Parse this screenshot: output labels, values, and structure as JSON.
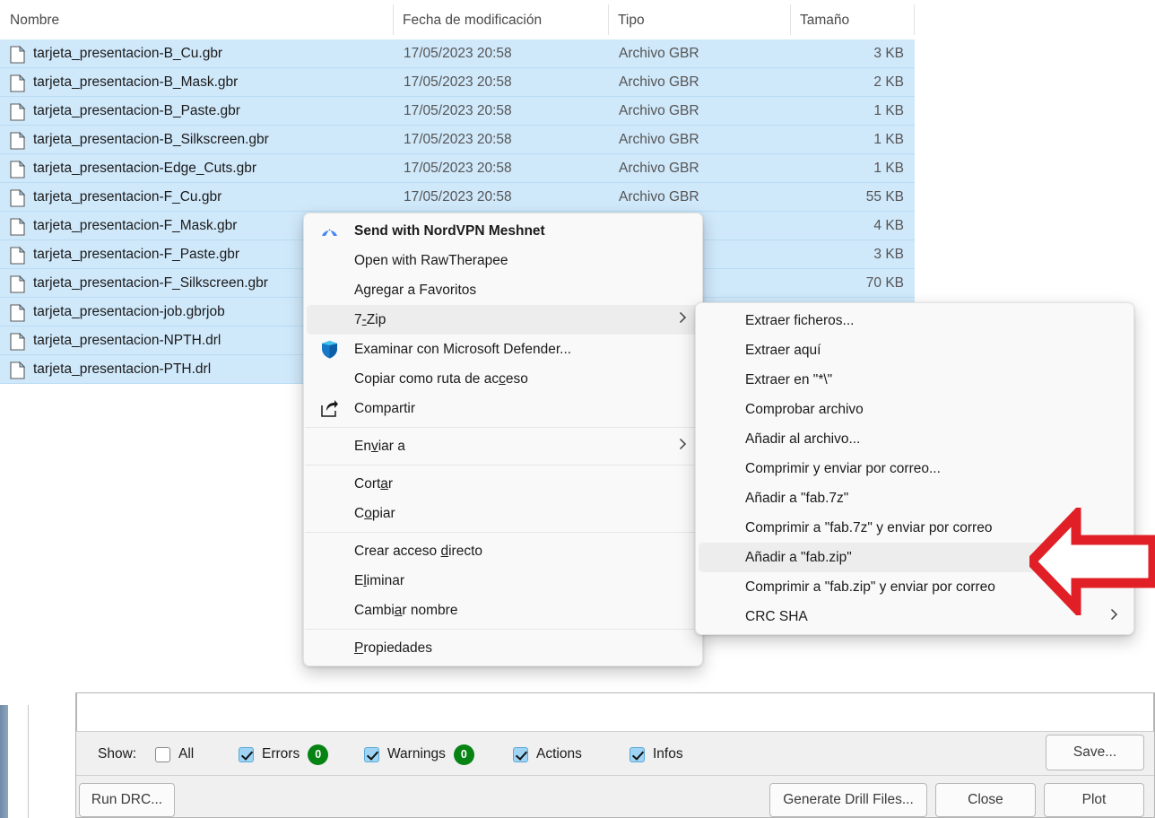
{
  "explorer": {
    "columns": [
      {
        "label": "Nombre",
        "key": "name"
      },
      {
        "label": "Fecha de modificación",
        "key": "date"
      },
      {
        "label": "Tipo",
        "key": "type"
      },
      {
        "label": "Tamaño",
        "key": "size"
      }
    ],
    "sort_indicator": "chevron-up-icon",
    "files": [
      {
        "name": "tarjeta_presentacion-B_Cu.gbr",
        "date": "17/05/2023 20:58",
        "type": "Archivo GBR",
        "size": "3 KB"
      },
      {
        "name": "tarjeta_presentacion-B_Mask.gbr",
        "date": "17/05/2023 20:58",
        "type": "Archivo GBR",
        "size": "2 KB"
      },
      {
        "name": "tarjeta_presentacion-B_Paste.gbr",
        "date": "17/05/2023 20:58",
        "type": "Archivo GBR",
        "size": "1 KB"
      },
      {
        "name": "tarjeta_presentacion-B_Silkscreen.gbr",
        "date": "17/05/2023 20:58",
        "type": "Archivo GBR",
        "size": "1 KB"
      },
      {
        "name": "tarjeta_presentacion-Edge_Cuts.gbr",
        "date": "17/05/2023 20:58",
        "type": "Archivo GBR",
        "size": "1 KB"
      },
      {
        "name": "tarjeta_presentacion-F_Cu.gbr",
        "date": "17/05/2023 20:58",
        "type": "Archivo GBR",
        "size": "55 KB"
      },
      {
        "name": "tarjeta_presentacion-F_Mask.gbr",
        "date": "",
        "type": "",
        "size": "4 KB"
      },
      {
        "name": "tarjeta_presentacion-F_Paste.gbr",
        "date": "",
        "type": "",
        "size": "3 KB"
      },
      {
        "name": "tarjeta_presentacion-F_Silkscreen.gbr",
        "date": "",
        "type": "",
        "size": "70 KB"
      },
      {
        "name": "tarjeta_presentacion-job.gbrjob",
        "date": "",
        "type": "",
        "size": ""
      },
      {
        "name": "tarjeta_presentacion-NPTH.drl",
        "date": "",
        "type": "",
        "size": ""
      },
      {
        "name": "tarjeta_presentacion-PTH.drl",
        "date": "",
        "type": "",
        "size": ""
      }
    ]
  },
  "context_menu": {
    "items": [
      {
        "label": "Send with NordVPN Meshnet",
        "icon": "nordvpn-icon",
        "bold": true,
        "submenu": false,
        "highlighted": false
      },
      {
        "label": "Open with RawTherapee",
        "icon": "",
        "bold": false,
        "submenu": false,
        "highlighted": false
      },
      {
        "label": "Agregar a Favoritos",
        "icon": "",
        "bold": false,
        "submenu": false,
        "highlighted": false
      },
      {
        "label": "7-Zip",
        "icon": "",
        "bold": false,
        "submenu": true,
        "highlighted": true
      },
      {
        "label": "Examinar con Microsoft Defender...",
        "icon": "defender-shield-icon",
        "bold": false,
        "submenu": false,
        "highlighted": false
      },
      {
        "label": "Copiar como ruta de acceso",
        "icon": "",
        "bold": false,
        "submenu": false,
        "highlighted": false
      },
      {
        "label": "Compartir",
        "icon": "share-icon",
        "bold": false,
        "submenu": false,
        "highlighted": false
      },
      {
        "separator": true
      },
      {
        "label": "Enviar a",
        "icon": "",
        "bold": false,
        "submenu": true,
        "highlighted": false
      },
      {
        "separator": true
      },
      {
        "label": "Cortar",
        "icon": "",
        "bold": false,
        "submenu": false,
        "highlighted": false
      },
      {
        "label": "Copiar",
        "icon": "",
        "bold": false,
        "submenu": false,
        "highlighted": false
      },
      {
        "separator": true
      },
      {
        "label": "Crear acceso directo",
        "icon": "",
        "bold": false,
        "submenu": false,
        "highlighted": false
      },
      {
        "label": "Eliminar",
        "icon": "",
        "bold": false,
        "submenu": false,
        "highlighted": false
      },
      {
        "label": "Cambiar nombre",
        "icon": "",
        "bold": false,
        "submenu": false,
        "highlighted": false
      },
      {
        "separator": true
      },
      {
        "label": "Propiedades",
        "icon": "",
        "bold": false,
        "submenu": false,
        "highlighted": false
      }
    ],
    "submenu_chevron": "chevron-right-icon"
  },
  "sevenzip_menu": {
    "items": [
      {
        "label": "Extraer ficheros...",
        "submenu": false,
        "highlighted": false
      },
      {
        "label": "Extraer aquí",
        "submenu": false,
        "highlighted": false
      },
      {
        "label": "Extraer en \"*\\\"",
        "submenu": false,
        "highlighted": false
      },
      {
        "label": "Comprobar archivo",
        "submenu": false,
        "highlighted": false
      },
      {
        "label": "Añadir al archivo...",
        "submenu": false,
        "highlighted": false
      },
      {
        "label": "Comprimir y enviar por correo...",
        "submenu": false,
        "highlighted": false
      },
      {
        "label": "Añadir a \"fab.7z\"",
        "submenu": false,
        "highlighted": false
      },
      {
        "label": "Comprimir a \"fab.7z\" y enviar por correo",
        "submenu": false,
        "highlighted": false
      },
      {
        "label": "Añadir a \"fab.zip\"",
        "submenu": false,
        "highlighted": true
      },
      {
        "label": "Comprimir a \"fab.zip\" y enviar por correo",
        "submenu": false,
        "highlighted": false
      },
      {
        "label": "CRC SHA",
        "submenu": true,
        "highlighted": false
      }
    ]
  },
  "annotation": {
    "arrow": "red-left-arrow-annotation",
    "color": "#E01F26"
  },
  "drc_dialog": {
    "show_label": "Show:",
    "filters": [
      {
        "label": "All",
        "checked": false,
        "count": null
      },
      {
        "label": "Errors",
        "checked": true,
        "count": "0"
      },
      {
        "label": "Warnings",
        "checked": true,
        "count": "0"
      },
      {
        "label": "Actions",
        "checked": true,
        "count": null
      },
      {
        "label": "Infos",
        "checked": true,
        "count": null
      }
    ],
    "badge_color": "#068313",
    "buttons": {
      "save": "Save...",
      "run_drc": "Run DRC...",
      "generate_drill": "Generate Drill Files...",
      "close": "Close",
      "plot": "Plot"
    }
  }
}
